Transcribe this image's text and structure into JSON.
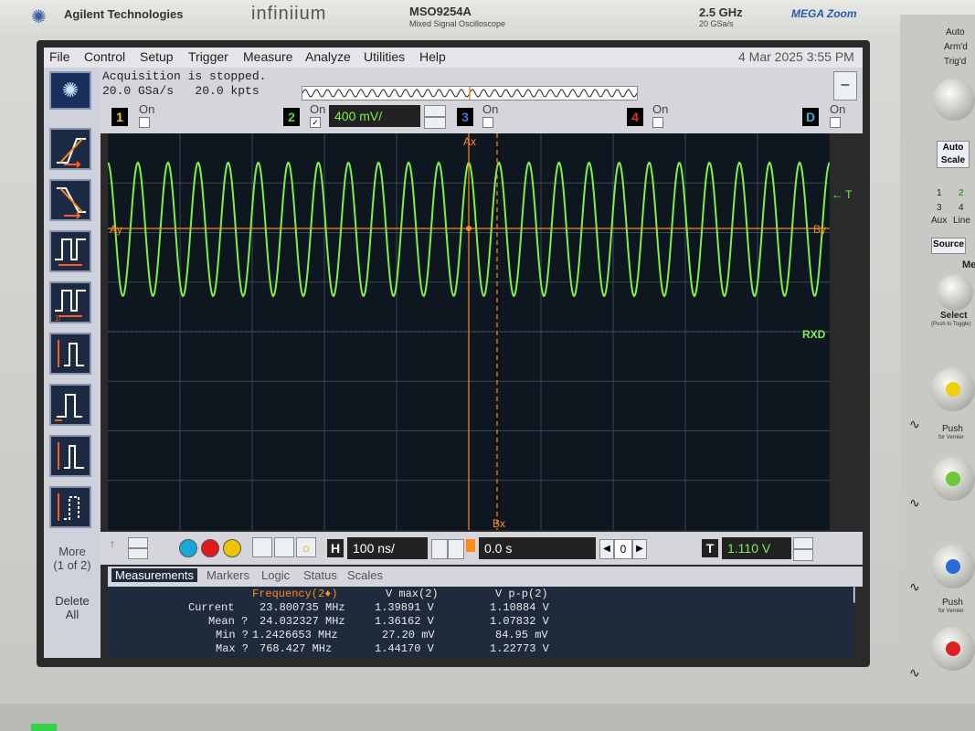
{
  "bezel": {
    "brand": "Agilent Technologies",
    "product_line": "infiniium",
    "model": "MSO9254A",
    "model_sub": "Mixed Signal Oscilloscope",
    "bandwidth": "2.5 GHz",
    "sample_rate": "20 GSa/s",
    "megazoom": "MEGA Zoom"
  },
  "menu": [
    "File",
    "Control",
    "Setup",
    "Trigger",
    "Measure",
    "Analyze",
    "Utilities",
    "Help"
  ],
  "datetime": "4 Mar 2025  3:55 PM",
  "acq": {
    "line1": "Acquisition is stopped.",
    "line2": "20.0 GSa/s   20.0 kpts"
  },
  "channels": {
    "ch1": {
      "num": "1",
      "state": "On",
      "color": "#f5d200"
    },
    "ch2": {
      "num": "2",
      "state": "On",
      "scale": "400 mV/",
      "color": "#5fd13a"
    },
    "ch3": {
      "num": "3",
      "state": "On",
      "color": "#3b7fd9"
    },
    "ch4": {
      "num": "4",
      "state": "On",
      "color": "#e03030"
    },
    "d": {
      "num": "D",
      "state": "On",
      "color": "#2fb5c8"
    }
  },
  "graticule": {
    "ax": "Ax",
    "bx_top": "Bx",
    "bx_bottom": "Bx",
    "ay": "Ay",
    "by": "By",
    "trigger": "← T",
    "rxd": "RXD"
  },
  "waveform": {
    "cycles": 24,
    "color": "#7cf24a",
    "cursor_color": "#ff8a1a"
  },
  "more": {
    "label": "More",
    "page": "(1 of 2)"
  },
  "delete_all": {
    "label": "Delete All"
  },
  "timebase": {
    "h_label": "H",
    "scale": "100 ns/",
    "delay": "0.0 s",
    "zoom": "0",
    "t_label": "T",
    "trig_level": "1.110 V"
  },
  "tabs": [
    "Measurements",
    "Markers",
    "Logic",
    "Status",
    "Scales"
  ],
  "measurements": {
    "headers": [
      "Frequency(2♦)",
      "V max(2)",
      "V p-p(2)"
    ],
    "rows": [
      {
        "label": "Current",
        "freq": "23.800735 MHz",
        "vmax": "1.39891 V",
        "vpp": "1.10884 V"
      },
      {
        "label": "Mean ?",
        "freq": "24.032327 MHz",
        "vmax": "1.36162 V",
        "vpp": "1.07832 V"
      },
      {
        "label": "Min ?",
        "freq": "1.2426653 MHz",
        "vmax": "27.20 mV",
        "vpp": "84.95 mV"
      },
      {
        "label": "Max ?",
        "freq": "768.427 MHz",
        "vmax": "1.44170 V",
        "vpp": "1.22773 V"
      }
    ]
  },
  "right_panel": {
    "auto": "Auto",
    "armd": "Arm'd",
    "trigd": "Trig'd",
    "autoscale": "Auto Scale",
    "n1": "1",
    "n2": "2",
    "n3": "3",
    "n4": "4",
    "aux": "Aux",
    "line": "Line",
    "source": "Source",
    "me": "Me",
    "select": "Select",
    "select_sub": "(Push to Toggle)",
    "push": "Push",
    "for_vernier": "for Vernier",
    "help": "?"
  }
}
